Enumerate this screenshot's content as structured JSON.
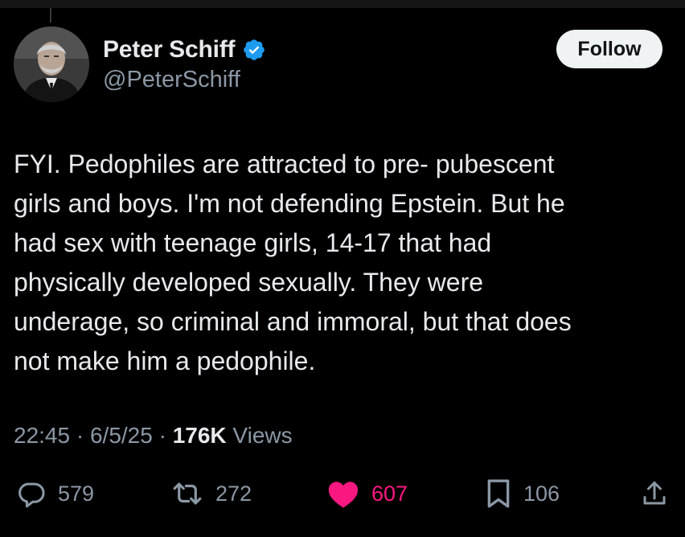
{
  "tweet": {
    "author": {
      "display_name": "Peter Schiff",
      "handle": "@PeterSchiff",
      "verified": true
    },
    "follow_label": "Follow",
    "text": "FYI. Pedophiles are attracted to pre- pubescent\ngirls and boys.  I'm not defending Epstein. But he\nhad sex with teenage girls, 14-17 that had\nphysically developed sexually. They were\nunderage, so criminal and immoral, but that does\nnot make him a pedophile.",
    "time": "22:45",
    "date": "6/5/25",
    "separator": " · ",
    "views_count": "176K",
    "views_label": " Views"
  },
  "actions": {
    "replies": "579",
    "reposts": "272",
    "likes": "607",
    "bookmarks": "106"
  },
  "colors": {
    "background": "#000000",
    "text": "#e7e9ea",
    "muted": "#8b98a5",
    "verified": "#1d9bf0",
    "like": "#f91880",
    "follow_bg": "#eff3f4"
  },
  "icons": [
    "verified-badge-icon",
    "reply-icon",
    "repost-icon",
    "heart-icon",
    "bookmark-icon",
    "share-icon"
  ]
}
